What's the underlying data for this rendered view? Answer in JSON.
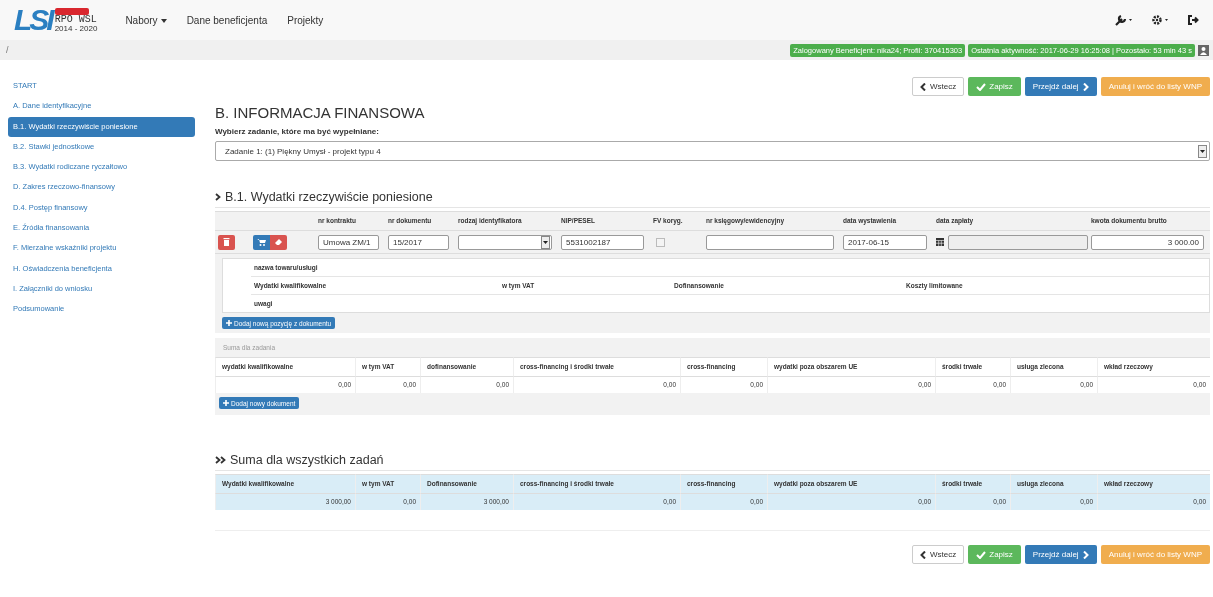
{
  "navbar": {
    "logo": {
      "mark": "LSI",
      "line1": "RPO WSL",
      "line2": "2014 - 2020"
    },
    "menu": [
      {
        "label": "Nabory",
        "dropdown": true
      },
      {
        "label": "Dane beneficjenta",
        "dropdown": false
      },
      {
        "label": "Projekty",
        "dropdown": false
      }
    ]
  },
  "breadcrumb": "/",
  "status_badges": [
    "Zalogowany Beneficjent: nika24; Profil: 370415303",
    "Ostatnia aktywność: 2017-06-29 16:25:08 | Pozostało: 53 min 43 s"
  ],
  "sidebar": {
    "items": [
      {
        "label": "START",
        "selected": false
      },
      {
        "label": "A. Dane identyfikacyjne",
        "selected": false
      },
      {
        "label": "B.1. Wydatki rzeczywiście poniesione",
        "selected": true
      },
      {
        "label": "B.2. Stawki jednostkowe",
        "selected": false
      },
      {
        "label": "B.3. Wydatki rodiczane ryczałtowo",
        "selected": false
      },
      {
        "label": "D. Zakres rzeczowo-finansowy",
        "selected": false
      },
      {
        "label": "D.4. Postęp finansowy",
        "selected": false
      },
      {
        "label": "E. Źródła finansowania",
        "selected": false
      },
      {
        "label": "F. Mierzalne wskaźniki projektu",
        "selected": false
      },
      {
        "label": "H. Oświadczenia beneficjenta",
        "selected": false
      },
      {
        "label": "I. Załączniki do wniosku",
        "selected": false
      },
      {
        "label": "Podsumowanie",
        "selected": false
      }
    ]
  },
  "actions_top": [
    {
      "label": "Wstecz",
      "kind": "back"
    },
    {
      "label": "Zapisz",
      "kind": "save"
    },
    {
      "label": "Przejdź dalej",
      "kind": "next"
    },
    {
      "label": "Anuluj i wróć do listy WNP",
      "kind": "cancel"
    }
  ],
  "heading": "B. INFORMACJA FINANSOWA",
  "task_select": {
    "label": "Wybierz zadanie, które ma być wypełniane:",
    "value": "Zadanie 1: (1) Piękny Umysł - projekt typu 4"
  },
  "section_title": "B.1. Wydatki rzeczywiście poniesione",
  "documents": {
    "columns": [
      "nr kontraktu",
      "nr dokumentu",
      "rodzaj identyfikatora",
      "NIP/PESEL",
      "FV koryg.",
      "nr księgowy/ewidencyjny",
      "data wystawienia",
      "data zapłaty",
      "kwota dokumentu brutto"
    ],
    "fields": [
      {
        "kind": "text",
        "value": "Umowa ZM/1"
      },
      {
        "kind": "text",
        "value": "15/2017"
      },
      {
        "kind": "select"
      },
      {
        "kind": "text",
        "value": "5531002187"
      },
      {
        "kind": "checkbox",
        "checked": false
      },
      {
        "kind": "text"
      },
      {
        "kind": "text",
        "value": "2017-06-15"
      },
      {
        "kind": "date"
      },
      {
        "kind": "amount",
        "value": "3 000.00"
      }
    ]
  },
  "items": {
    "name_label": "nazwa towaru/usługi",
    "columns": [
      "Wydatki kwalifikowalne",
      "w tym VAT",
      "Dofinansowanie",
      "Koszty limitowane"
    ],
    "notes_label": "uwagi",
    "add_button": "Dodaj nową pozycję z dokumentu"
  },
  "task_sum": {
    "title": "Suma dla zadania",
    "columns": [
      "wydatki kwalifikowalne",
      "w tym VAT",
      "dofinansowanie",
      "cross-financing i środki trwałe",
      "cross-financing",
      "wydatki poza obszarem UE",
      "środki trwałe",
      "usługa zlecona",
      "wkład rzeczowy"
    ],
    "values": [
      "0,00",
      "0,00",
      "0,00",
      "0,00",
      "0,00",
      "0,00",
      "0,00",
      "0,00",
      "0,00"
    ],
    "add_button": "Dodaj nowy dokument"
  },
  "all_sum": {
    "title": "Suma dla wszystkich zadań",
    "columns": [
      "Wydatki kwalifikowalne",
      "w tym VAT",
      "Dofinansowanie",
      "cross-financing i środki trwałe",
      "cross-financing",
      "wydatki poza obszarem UE",
      "środki trwałe",
      "usługa zlecona",
      "wkład rzeczowy"
    ],
    "values": [
      "3 000,00",
      "0,00",
      "3 000,00",
      "0,00",
      "0,00",
      "0,00",
      "0,00",
      "0,00",
      "0,00"
    ]
  },
  "actions_bottom": [
    {
      "label": "Wstecz",
      "kind": "back"
    },
    {
      "label": "Zapisz",
      "kind": "save"
    },
    {
      "label": "Przejdź dalej",
      "kind": "next"
    },
    {
      "label": "Anuluj i wróć do listy WNP",
      "kind": "cancel"
    }
  ]
}
